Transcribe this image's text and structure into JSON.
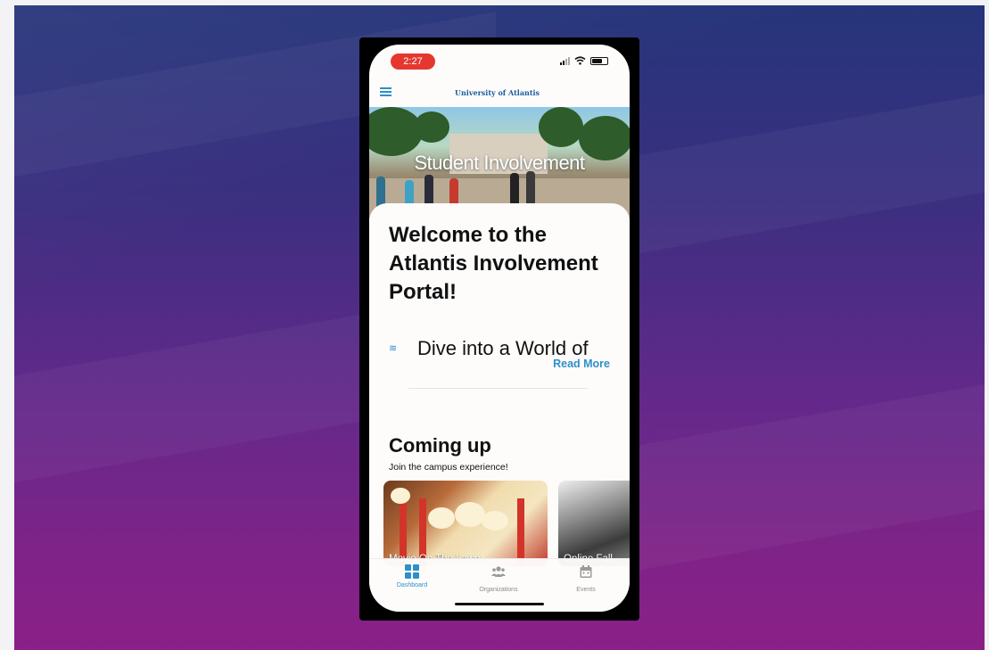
{
  "status_bar": {
    "time": "2:27"
  },
  "header": {
    "title": "University of Atlantis"
  },
  "hero": {
    "title": "Student Involvement"
  },
  "welcome": {
    "heading": "Welcome to the Atlantis Involvement Portal!",
    "teaser": "Dive into a World of",
    "read_more": "Read More"
  },
  "coming_up": {
    "title": "Coming up",
    "subtitle": "Join the campus experience!",
    "events": [
      {
        "label": "Movie On The Lawn"
      },
      {
        "label": "Online Fall"
      }
    ]
  },
  "tabs": [
    {
      "label": "Dashboard",
      "icon": "dashboard-icon",
      "active": true
    },
    {
      "label": "Organizations",
      "icon": "people-icon",
      "active": false
    },
    {
      "label": "Events",
      "icon": "calendar-icon",
      "active": false
    }
  ],
  "colors": {
    "accent": "#2e8fc9",
    "time_pill": "#e5372f",
    "background_top": "#26357a",
    "background_bottom": "#8a2088"
  }
}
